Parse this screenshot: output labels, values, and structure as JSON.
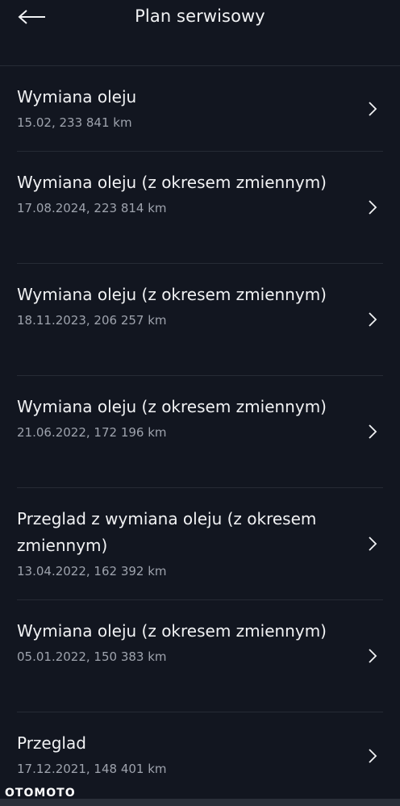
{
  "header": {
    "title": "Plan serwisowy",
    "back_icon": "arrow-left-icon"
  },
  "items": [
    {
      "name": "Wymiana oleju",
      "meta": "15.02, 233 841 km"
    },
    {
      "name": "Wymiana oleju (z okresem zmiennym)",
      "meta": "17.08.2024, 223 814 km"
    },
    {
      "name": "Wymiana oleju (z okresem zmiennym)",
      "meta": "18.11.2023, 206 257 km"
    },
    {
      "name": "Wymiana oleju (z okresem zmiennym)",
      "meta": "21.06.2022, 172 196 km"
    },
    {
      "name": "Przeglad z wymiana oleju (z okresem zmiennym)",
      "meta": "13.04.2022, 162 392 km"
    },
    {
      "name": "Wymiana oleju (z okresem zmiennym)",
      "meta": "05.01.2022, 150 383 km"
    },
    {
      "name": "Przeglad",
      "meta": "17.12.2021, 148 401 km"
    }
  ],
  "watermark": "OTOMOTO",
  "colors": {
    "background": "#121620",
    "text": "#f1f2f4",
    "secondary_text": "#9ea3ad",
    "divider": "#262b35"
  }
}
